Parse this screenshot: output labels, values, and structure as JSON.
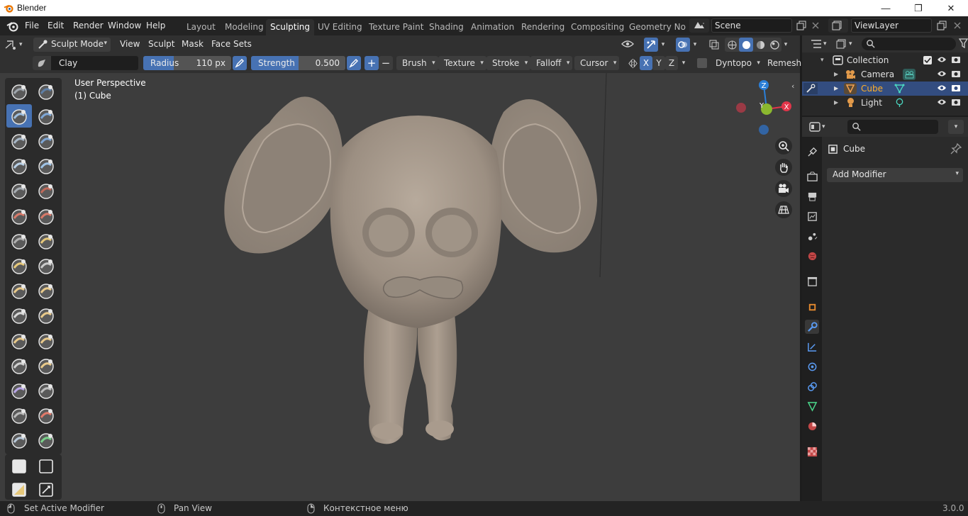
{
  "window": {
    "app_title": "Blender",
    "min": "—",
    "max": "❐",
    "close": "✕"
  },
  "menus": [
    "File",
    "Edit",
    "Render",
    "Window",
    "Help"
  ],
  "workspaces": [
    "Layout",
    "Modeling",
    "Sculpting",
    "UV Editing",
    "Texture Paint",
    "Shading",
    "Animation",
    "Rendering",
    "Compositing",
    "Geometry Nod"
  ],
  "active_workspace": "Sculpting",
  "scene": {
    "label": "Scene"
  },
  "viewlayer": {
    "label": "ViewLayer"
  },
  "viewport_header": {
    "mode": "Sculpt Mode",
    "menus": [
      "View",
      "Sculpt",
      "Mask",
      "Face Sets"
    ]
  },
  "tool_header": {
    "brush_name": "Clay",
    "radius": {
      "label": "Radius",
      "value": "110 px",
      "fraction": 0.35
    },
    "strength": {
      "label": "Strength",
      "value": "0.500",
      "fraction": 0.5
    },
    "dropdowns": [
      "Brush",
      "Texture",
      "Stroke",
      "Falloff",
      "Cursor"
    ],
    "axes": [
      "X",
      "Y",
      "Z"
    ],
    "dyntopo": "Dyntopo",
    "remesh": "Remesh"
  },
  "viewport": {
    "perspective": "User Perspective",
    "object": "(1) Cube"
  },
  "gizmo": {
    "z": "Z",
    "y": "Y",
    "x": "X"
  },
  "outliner": {
    "rows": [
      {
        "label": "Collection",
        "icon": "collection-icon"
      },
      {
        "label": "Camera",
        "icon": "camera-object-icon"
      },
      {
        "label": "Cube",
        "icon": "mesh-object-icon"
      },
      {
        "label": "Light",
        "icon": "light-object-icon"
      }
    ]
  },
  "properties": {
    "object_name": "Cube",
    "add_modifier": "Add Modifier"
  },
  "status": {
    "left": "Set Active Modifier",
    "mid": "Pan View",
    "right": "Контекстное меню",
    "version": "3.0.0"
  },
  "colors": {
    "accent": "#4772b3",
    "header": "#303030",
    "viewport": "#3d3d3d",
    "axis_x": "#e2354a",
    "axis_y": "#8bb82f",
    "axis_z": "#2b7fd8"
  }
}
